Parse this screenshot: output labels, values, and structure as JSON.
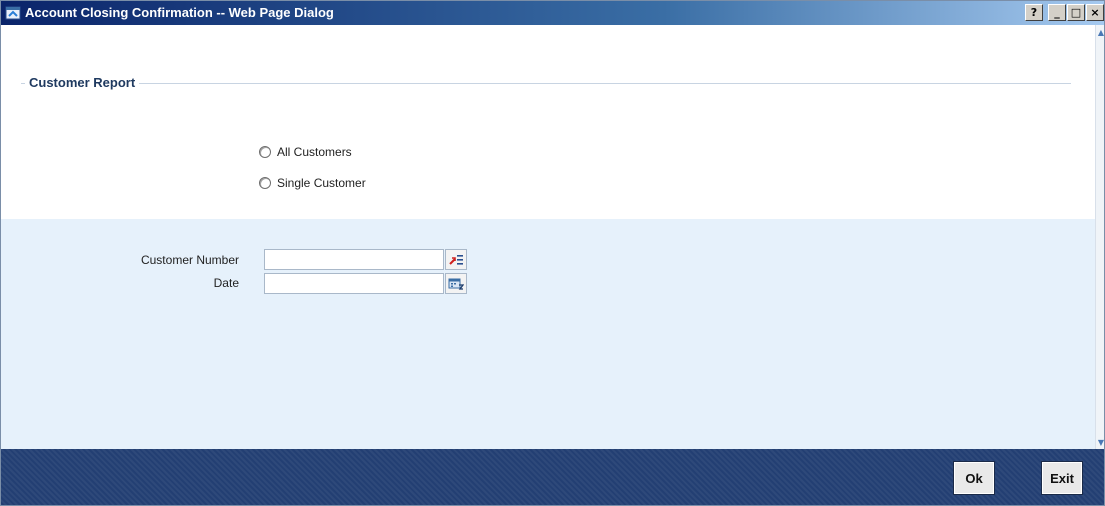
{
  "window": {
    "title": "Account Closing Confirmation -- Web Page Dialog",
    "help_glyph": "?",
    "minimize_glyph": "_",
    "maximize_glyph": "□",
    "close_glyph": "×"
  },
  "section": {
    "legend": "Customer Report"
  },
  "options": {
    "all_customers": "All Customers",
    "single_customer": "Single Customer"
  },
  "form": {
    "customer_number_label": "Customer Number",
    "customer_number_value": "",
    "date_label": "Date",
    "date_value": ""
  },
  "footer": {
    "ok_label": "Ok",
    "exit_label": "Exit"
  },
  "icons": {
    "app": "ie-dialog-icon",
    "lookup": "list-lookup-icon",
    "calendar": "calendar-icon"
  },
  "colors": {
    "title_start": "#0a246a",
    "title_end": "#a6caf0",
    "legend_text": "#1f3a60",
    "panel_blue": "#e6f1fb",
    "footer": "#233f73"
  }
}
